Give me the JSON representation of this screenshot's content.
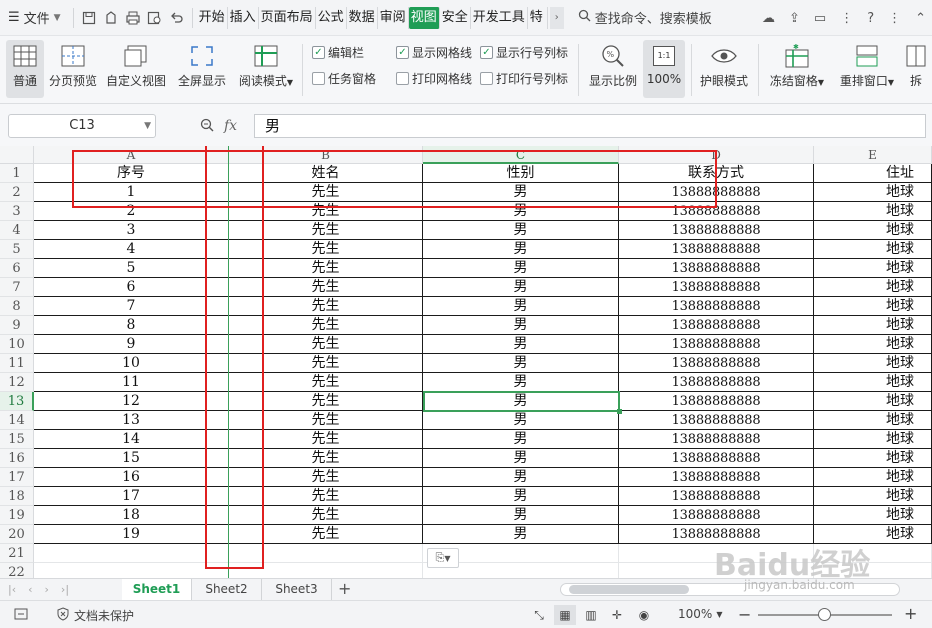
{
  "menubar": {
    "file_label": "文件",
    "tabs": [
      "开始",
      "插入",
      "页面布局",
      "公式",
      "数据",
      "审阅",
      "视图",
      "安全",
      "开发工具",
      "特色"
    ],
    "active_tab": "视图",
    "search_label": "查找命令、搜索模板"
  },
  "ribbon": {
    "buttons": [
      {
        "label": "普通",
        "icon": "normal-view-icon",
        "selected": true
      },
      {
        "label": "分页预览",
        "icon": "page-break-preview-icon"
      },
      {
        "label": "自定义视图",
        "icon": "custom-view-icon"
      },
      {
        "label": "全屏显示",
        "icon": "fullscreen-icon"
      },
      {
        "label": "阅读模式",
        "icon": "reading-mode-icon"
      }
    ],
    "checkboxes": [
      {
        "label": "编辑栏",
        "checked": true
      },
      {
        "label": "显示网格线",
        "checked": true
      },
      {
        "label": "显示行号列标",
        "checked": true
      },
      {
        "label": "任务窗格",
        "checked": false
      },
      {
        "label": "打印网格线",
        "checked": false
      },
      {
        "label": "打印行号列标",
        "checked": false
      }
    ],
    "zoom_label": "显示比例",
    "zoom100_label": "100%",
    "zoom100_icon_text": "1:1",
    "eye_label": "护眼模式",
    "freeze_label": "冻结窗格",
    "rearrange_label": "重排窗口",
    "split_label": "拆"
  },
  "formula": {
    "name_box": "C13",
    "fx": "fx",
    "value": "男"
  },
  "columns": [
    "A",
    "B",
    "C",
    "D",
    "E"
  ],
  "rows": [
    "1",
    "2",
    "3",
    "4",
    "5",
    "6",
    "7",
    "8",
    "9",
    "10",
    "11",
    "12",
    "13",
    "14",
    "15",
    "16",
    "17",
    "18",
    "19",
    "20",
    "21",
    "22"
  ],
  "header_row": [
    "序号",
    "姓名",
    "性别",
    "联系方式",
    "住址"
  ],
  "data_rows": [
    [
      "1",
      "先生",
      "男",
      "13888888888",
      "地球"
    ],
    [
      "2",
      "先生",
      "男",
      "13888888888",
      "地球"
    ],
    [
      "3",
      "先生",
      "男",
      "13888888888",
      "地球"
    ],
    [
      "4",
      "先生",
      "男",
      "13888888888",
      "地球"
    ],
    [
      "5",
      "先生",
      "男",
      "13888888888",
      "地球"
    ],
    [
      "6",
      "先生",
      "男",
      "13888888888",
      "地球"
    ],
    [
      "7",
      "先生",
      "男",
      "13888888888",
      "地球"
    ],
    [
      "8",
      "先生",
      "男",
      "13888888888",
      "地球"
    ],
    [
      "9",
      "先生",
      "男",
      "13888888888",
      "地球"
    ],
    [
      "10",
      "先生",
      "男",
      "13888888888",
      "地球"
    ],
    [
      "11",
      "先生",
      "男",
      "13888888888",
      "地球"
    ],
    [
      "12",
      "先生",
      "男",
      "13888888888",
      "地球"
    ],
    [
      "13",
      "先生",
      "男",
      "13888888888",
      "地球"
    ],
    [
      "14",
      "先生",
      "男",
      "13888888888",
      "地球"
    ],
    [
      "15",
      "先生",
      "男",
      "13888888888",
      "地球"
    ],
    [
      "16",
      "先生",
      "男",
      "13888888888",
      "地球"
    ],
    [
      "17",
      "先生",
      "男",
      "13888888888",
      "地球"
    ],
    [
      "18",
      "先生",
      "男",
      "13888888888",
      "地球"
    ],
    [
      "19",
      "先生",
      "男",
      "13888888888",
      "地球"
    ]
  ],
  "sheets": [
    "Sheet1",
    "Sheet2",
    "Sheet3"
  ],
  "active_sheet": "Sheet1",
  "status": {
    "protect_label": "文档未保护",
    "zoom": "100%"
  },
  "watermark": {
    "brand": "Baidu经验",
    "url": "jingyan.baidu.com"
  },
  "colors": {
    "accent": "#1f9d55",
    "highlight_red": "#e02020",
    "select_green": "#3aa05a"
  }
}
